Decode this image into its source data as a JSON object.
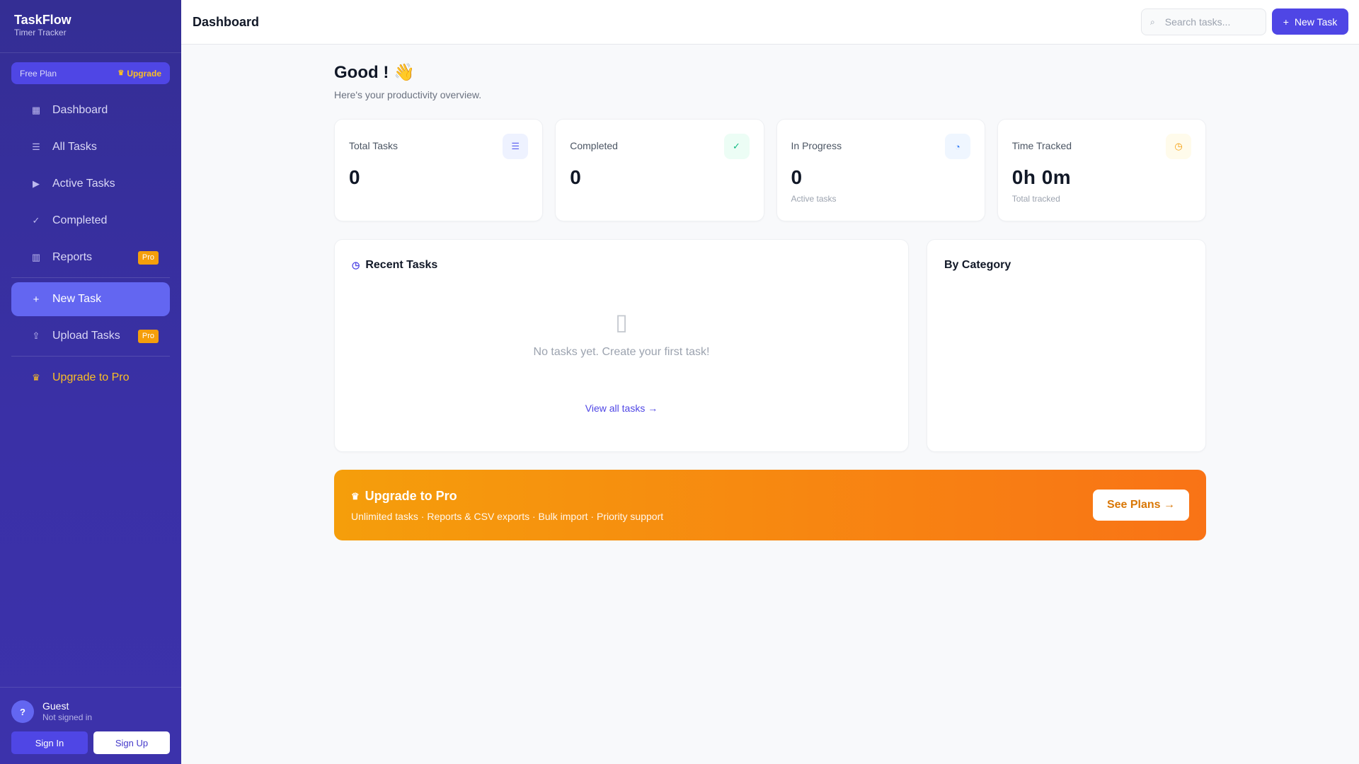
{
  "sidebar": {
    "brand_title": "TaskFlow",
    "brand_subtitle": "Timer Tracker",
    "plan_name": "Free Plan",
    "plan_upgrade": "Upgrade",
    "items": [
      {
        "label": "Dashboard",
        "icon": "grid-icon"
      },
      {
        "label": "All Tasks",
        "icon": "list-icon"
      },
      {
        "label": "Active Tasks",
        "icon": "play-icon"
      },
      {
        "label": "Completed",
        "icon": "check-icon"
      },
      {
        "label": "Reports",
        "icon": "chart-icon",
        "badge": "Pro"
      },
      {
        "label": "New Task",
        "icon": "plus-icon",
        "glyph": "+"
      },
      {
        "label": "Upload Tasks",
        "icon": "upload-icon",
        "badge": "Pro"
      },
      {
        "label": "Upgrade to Pro",
        "icon": "crown-icon"
      }
    ],
    "active_item": "New Task",
    "user": {
      "avatar": "?",
      "name": "Guest",
      "status": "Not signed in",
      "sign_in": "Sign In",
      "sign_up": "Sign Up"
    }
  },
  "header": {
    "title": "Dashboard",
    "search_placeholder": "Search tasks...",
    "new_task_icon": "+",
    "new_task_label": "New Task"
  },
  "main": {
    "greeting": "Good ! 👋",
    "subtitle": "Here's your productivity overview.",
    "stats": [
      {
        "label": "Total Tasks",
        "value": "0",
        "foot": "",
        "icon": "tasks-icon",
        "color": "#eef2ff",
        "icon_color": "#6366f1"
      },
      {
        "label": "Completed",
        "value": "0",
        "foot": "",
        "icon": "check-circle-icon",
        "color": "#ecfdf5",
        "icon_color": "#10b981"
      },
      {
        "label": "In Progress",
        "value": "0",
        "foot": "Active tasks",
        "icon": "spinner-icon",
        "color": "#eff6ff",
        "icon_color": "#3b82f6"
      },
      {
        "label": "Time Tracked",
        "value": "0h 0m",
        "foot": "Total tracked",
        "icon": "clock-icon",
        "color": "#fffbeb",
        "icon_color": "#f59e0b"
      }
    ],
    "recent": {
      "title": "Recent Tasks",
      "empty": "No tasks yet. Create your first task!",
      "view_all": "View all tasks →"
    },
    "category": {
      "title": "By Category"
    },
    "promo": {
      "title": "Upgrade to Pro",
      "text": "Unlimited tasks · Reports & CSV exports · Bulk import · Priority support",
      "button": "See Plans →"
    }
  },
  "colors": {
    "accent": "#4f46e5",
    "sidebar": "#3a30a6",
    "pro_badge": "#f59e0b",
    "promo_start": "#f59e0b",
    "promo_end": "#f97316"
  }
}
